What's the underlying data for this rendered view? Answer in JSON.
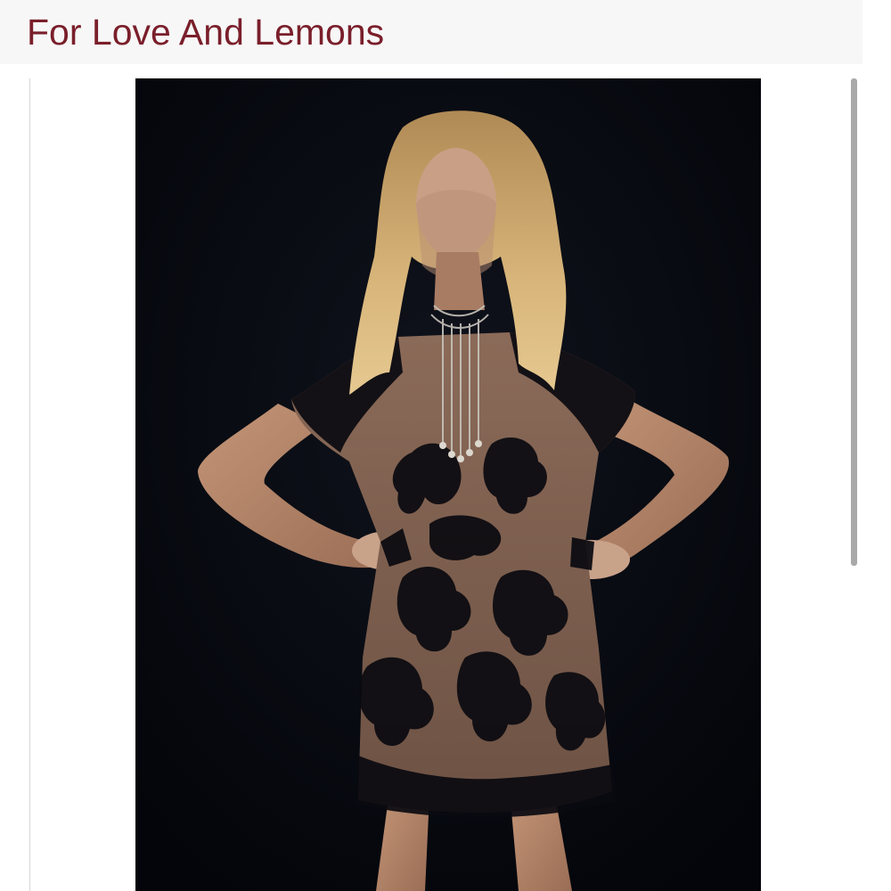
{
  "header": {
    "title": "For Love And Lemons",
    "title_color": "#7a1f2b",
    "background": "#f7f7f7"
  },
  "product_image": {
    "icon": "product-photo",
    "background_color": "#05070d"
  },
  "scrollbar": {
    "position_fraction": 0.0,
    "visible_fraction": 0.6
  }
}
